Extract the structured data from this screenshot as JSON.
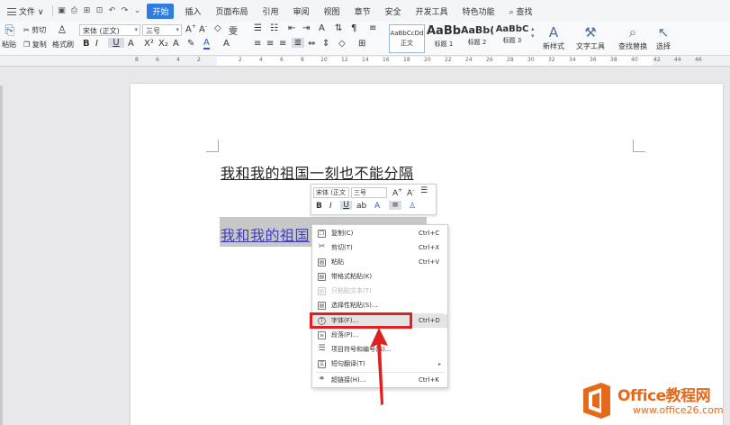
{
  "menubar": {
    "file": "文件",
    "tabs": [
      "开始",
      "插入",
      "页面布局",
      "引用",
      "审阅",
      "视图",
      "章节",
      "安全",
      "开发工具",
      "特色功能"
    ],
    "active_tab": "开始",
    "search": "查找",
    "quick_icons": [
      "save-icon",
      "print-icon",
      "undo-icon",
      "redo-icon"
    ]
  },
  "ribbon": {
    "cut": "剪切",
    "paste": "粘贴",
    "copy": "复制",
    "format_painter": "格式刷",
    "font_name": "宋体 (正文)",
    "font_size": "三号",
    "styles": [
      {
        "sample": "AaBbCcDd",
        "caption": "正文"
      },
      {
        "sample": "AaBb",
        "caption": "标题 1"
      },
      {
        "sample": "AaBb(",
        "caption": "标题 2"
      },
      {
        "sample": "AaBbC",
        "caption": "标题 3"
      }
    ],
    "new_style": "新样式",
    "text_tools": "文字工具",
    "find_replace": "查找替换",
    "select": "选择"
  },
  "ruler": {
    "labels": [
      "8",
      "6",
      "4",
      "2",
      "2",
      "4",
      "6",
      "8",
      "10",
      "12",
      "14",
      "16",
      "18",
      "20",
      "22",
      "24",
      "26",
      "28",
      "30",
      "32",
      "34",
      "36",
      "38",
      "40",
      "42",
      "44",
      "46"
    ]
  },
  "document": {
    "line1": "我和我的祖国一刻也不能分隔",
    "line2": "我和我的祖国"
  },
  "mini_toolbar": {
    "font": "宋体 (正文",
    "size": "三号"
  },
  "context_menu": {
    "items": [
      {
        "label": "复制(C)",
        "shortcut": "Ctrl+C",
        "icon": "copy-icon",
        "state": "normal"
      },
      {
        "label": "剪切(T)",
        "shortcut": "Ctrl+X",
        "icon": "cut-icon",
        "state": "normal"
      },
      {
        "label": "粘贴",
        "shortcut": "Ctrl+V",
        "icon": "paste-icon",
        "state": "normal"
      },
      {
        "label": "带格式粘贴(K)",
        "shortcut": "",
        "icon": "paste-format-icon",
        "state": "normal"
      },
      {
        "label": "只粘贴文本(T)",
        "shortcut": "",
        "icon": "paste-text-icon",
        "state": "disabled"
      },
      {
        "label": "选择性粘贴(S)...",
        "shortcut": "",
        "icon": "paste-special-icon",
        "state": "normal"
      },
      {
        "label": "字体(F)...",
        "shortcut": "Ctrl+D",
        "icon": "font-icon",
        "state": "highlighted"
      },
      {
        "label": "段落(P)...",
        "shortcut": "",
        "icon": "paragraph-icon",
        "state": "normal"
      },
      {
        "label": "项目符号和编号(N)...",
        "shortcut": "",
        "icon": "bullets-icon",
        "state": "normal"
      },
      {
        "label": "短句翻译(T)",
        "shortcut": "",
        "icon": "translate-icon",
        "state": "normal"
      },
      {
        "label": "超链接(H)...",
        "shortcut": "Ctrl+K",
        "icon": "link-icon",
        "state": "normal"
      }
    ]
  },
  "watermark": {
    "brand": "Office教程网",
    "url": "www.office26.com"
  },
  "colors": {
    "accent": "#2f7de1",
    "highlight_box": "#e02020",
    "watermark": "#e6691a"
  }
}
